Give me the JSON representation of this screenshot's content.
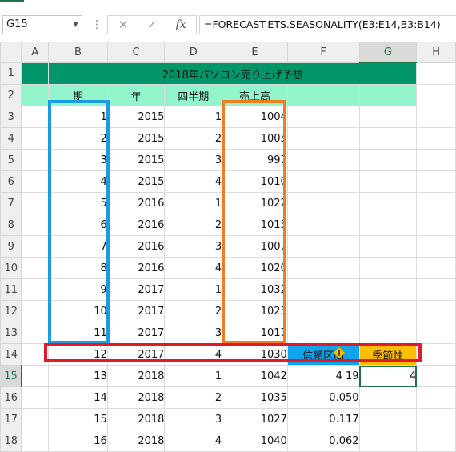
{
  "formula_bar": {
    "name_box": "G15",
    "cancel_icon": "✕",
    "enter_icon": "✓",
    "fx_label": "fx",
    "formula": "=FORECAST.ETS.SEASONALITY(E3:E14,B3:B14)"
  },
  "columns": [
    "A",
    "B",
    "C",
    "D",
    "E",
    "F",
    "G",
    "H"
  ],
  "rows": [
    "1",
    "2",
    "3",
    "4",
    "5",
    "6",
    "7",
    "8",
    "9",
    "10",
    "11",
    "12",
    "13",
    "14",
    "15",
    "16",
    "17",
    "18"
  ],
  "sheet": {
    "title": "2018年パソコン売り上げ予想",
    "headers": {
      "period": "期",
      "year": "年",
      "quarter": "四半期",
      "sales": "売上高"
    },
    "data": [
      {
        "period": "1",
        "year": "2015",
        "quarter": "1",
        "sales": "1004"
      },
      {
        "period": "2",
        "year": "2015",
        "quarter": "2",
        "sales": "1005"
      },
      {
        "period": "3",
        "year": "2015",
        "quarter": "3",
        "sales": "997"
      },
      {
        "period": "4",
        "year": "2015",
        "quarter": "4",
        "sales": "1010"
      },
      {
        "period": "5",
        "year": "2016",
        "quarter": "1",
        "sales": "1022"
      },
      {
        "period": "6",
        "year": "2016",
        "quarter": "2",
        "sales": "1015"
      },
      {
        "period": "7",
        "year": "2016",
        "quarter": "3",
        "sales": "1007"
      },
      {
        "period": "8",
        "year": "2016",
        "quarter": "4",
        "sales": "1020"
      },
      {
        "period": "9",
        "year": "2017",
        "quarter": "1",
        "sales": "1032"
      },
      {
        "period": "10",
        "year": "2017",
        "quarter": "2",
        "sales": "1025"
      },
      {
        "period": "11",
        "year": "2017",
        "quarter": "3",
        "sales": "1017"
      },
      {
        "period": "12",
        "year": "2017",
        "quarter": "4",
        "sales": "1030"
      }
    ],
    "confidence_label": "信頼区間",
    "seasonality_label": "季節性",
    "forecast": [
      {
        "period": "13",
        "year": "2018",
        "quarter": "1",
        "sales": "1042",
        "confidence": "4 19",
        "seasonality": "4"
      },
      {
        "period": "14",
        "year": "2018",
        "quarter": "2",
        "sales": "1035",
        "confidence": "0.050"
      },
      {
        "period": "15",
        "year": "2018",
        "quarter": "3",
        "sales": "1027",
        "confidence": "0.117"
      },
      {
        "period": "16",
        "year": "2018",
        "quarter": "4",
        "sales": "1040",
        "confidence": "0.062"
      }
    ]
  },
  "colors": {
    "title_fill": "#00966a",
    "header_fill": "#93f5cc",
    "confidence_fill": "#0fa5ec",
    "seasonality_fill": "#ffbe00",
    "highlight_blue": "#1a9de0",
    "highlight_orange": "#ef7d22",
    "highlight_red": "#e01a2a",
    "excel_green": "#217346"
  }
}
